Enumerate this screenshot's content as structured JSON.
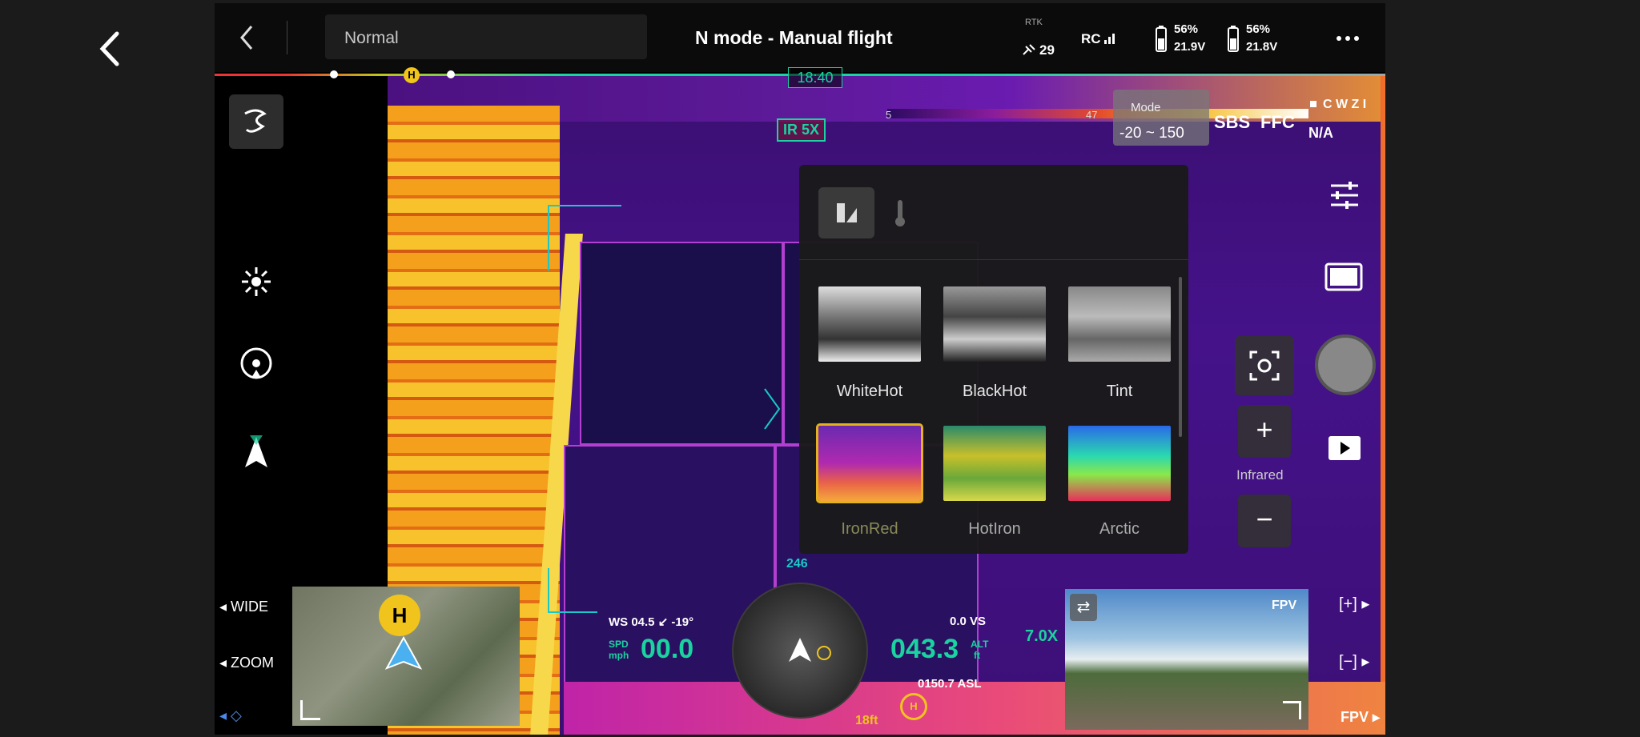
{
  "colors": {
    "accent": "#19d4a0",
    "home": "#f0c41c",
    "selected_outline": "#e3b21c"
  },
  "topbar": {
    "back_icon": "chevron-left-icon",
    "mode_select_value": "Normal",
    "flight_mode": "N mode - Manual flight",
    "rtk_label": "RTK",
    "satellites": "29",
    "rc_label": "RC",
    "battery1_pct": "56%",
    "battery1_volt": "21.9V",
    "battery2_pct": "56%",
    "battery2_volt": "21.8V",
    "more_icon": "more-icon"
  },
  "timeline": {
    "time": "18:40",
    "home_label": "H"
  },
  "camera": {
    "zoom_badge": "IR 5X",
    "range_mode_label": "Mode",
    "range_min_label": "5",
    "range_max_label": "47",
    "range": "-20 ~ 150",
    "sbs": "SBS",
    "ffc": "FFC",
    "cwzi": "C W Z I",
    "cwzi_value": "N/A"
  },
  "palette_panel": {
    "tabs": [
      "palette-tab-icon",
      "thermometer-icon"
    ],
    "items": [
      {
        "label": "WhiteHot",
        "selected": false
      },
      {
        "label": "BlackHot",
        "selected": false
      },
      {
        "label": "Tint",
        "selected": false
      },
      {
        "label": "IronRed",
        "selected": true
      },
      {
        "label": "HotIron",
        "selected": false
      },
      {
        "label": "Arctic",
        "selected": false
      }
    ]
  },
  "right_controls": {
    "zoom_plus": "+",
    "zoom_minus": "−",
    "infrared_label": "Infrared"
  },
  "left_controls": {
    "wide_label": "WIDE",
    "zoom_label": "ZOOM"
  },
  "telemetry": {
    "heading": "246",
    "wind": "WS 04.5 ↙ -19°",
    "spd_label": "SPD",
    "spd_unit": "mph",
    "speed": "00.0",
    "vs": "0.0 VS",
    "altitude": "043.3",
    "alt_label": "ALT",
    "alt_unit": "ft",
    "asl": "0150.7 ASL",
    "zoom_level": "7.0X",
    "home_dist": "18ft"
  },
  "fpv": {
    "label": "FPV",
    "bottom_label": "FPV",
    "plus_label": "[+]",
    "minus_label": "[−]"
  }
}
